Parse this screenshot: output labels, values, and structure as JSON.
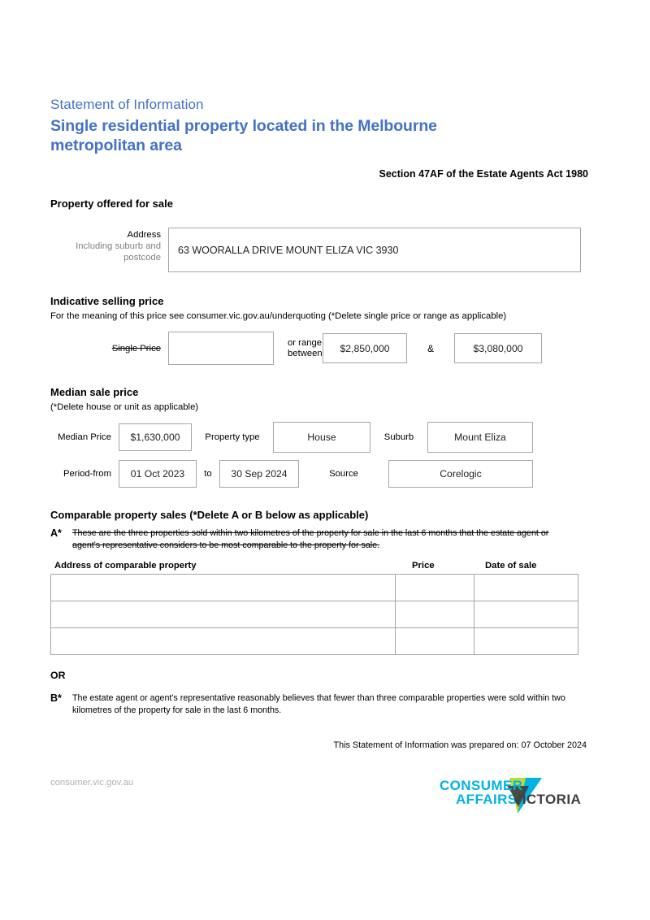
{
  "header": {
    "eyebrow": "Statement of Information",
    "title_line1": "Single residential property located in the Melbourne",
    "title_line2": "metropolitan area",
    "act_reference": "Section 47AF of the Estate Agents Act 1980",
    "accent_color": "#4472c4"
  },
  "property_offered": {
    "heading": "Property offered for sale",
    "address_label_line1": "Address",
    "address_label_line2": "Including suburb and",
    "address_label_line3": "postcode",
    "address_value": "63 WOORALLA DRIVE MOUNT ELIZA VIC 3930"
  },
  "indicative_price": {
    "heading": "Indicative selling price",
    "note": "For the meaning of this price see consumer.vic.gov.au/underquoting (*Delete single price or range as applicable)",
    "single_price_label": "Single Price",
    "single_price_value": "",
    "or_range_line1": "or range",
    "or_range_line2": "between",
    "range_low": "$2,850,000",
    "ampersand": "&",
    "range_high": "$3,080,000"
  },
  "median_price": {
    "heading": "Median sale price",
    "note": "(*Delete house or unit as applicable)",
    "median_price_label": "Median Price",
    "median_price_value": "$1,630,000",
    "property_type_label": "Property type",
    "property_type_value": "House",
    "suburb_label": "Suburb",
    "suburb_value": "Mount Eliza",
    "period_from_label": "Period-from",
    "period_from_value": "01 Oct 2023",
    "to_label": "to",
    "period_to_value": "30 Sep 2024",
    "source_label": "Source",
    "source_value": "Corelogic"
  },
  "comparable_sales": {
    "heading": "Comparable property sales (*Delete A or B below as applicable)",
    "option_a_mark": "A*",
    "option_a_text": "These are the three properties sold within two kilometres of the property for sale in the last 6 months that the estate agent or agent's representative considers to be most comparable to the property for sale.",
    "table_headers": {
      "address": "Address of comparable property",
      "price": "Price",
      "date": "Date of sale"
    },
    "rows": [
      {
        "address": "",
        "price": "",
        "date": ""
      },
      {
        "address": "",
        "price": "",
        "date": ""
      },
      {
        "address": "",
        "price": "",
        "date": ""
      }
    ],
    "or_label": "OR",
    "option_b_mark": "B*",
    "option_b_text": "The estate agent or agent's representative reasonably believes that fewer than three comparable properties were sold within two kilometres of the property for sale in the last 6 months."
  },
  "prepared": {
    "text": "This Statement of Information was prepared on: 07 October 2024"
  },
  "footer": {
    "url": "consumer.vic.gov.au",
    "logo_line1": "CONSUMER",
    "logo_line2": "AFFAIRS",
    "logo_word": "VICTORIA",
    "logo_cyan": "#00b3e3",
    "logo_green": "#c4d92e",
    "logo_dark": "#3f3f3f"
  }
}
